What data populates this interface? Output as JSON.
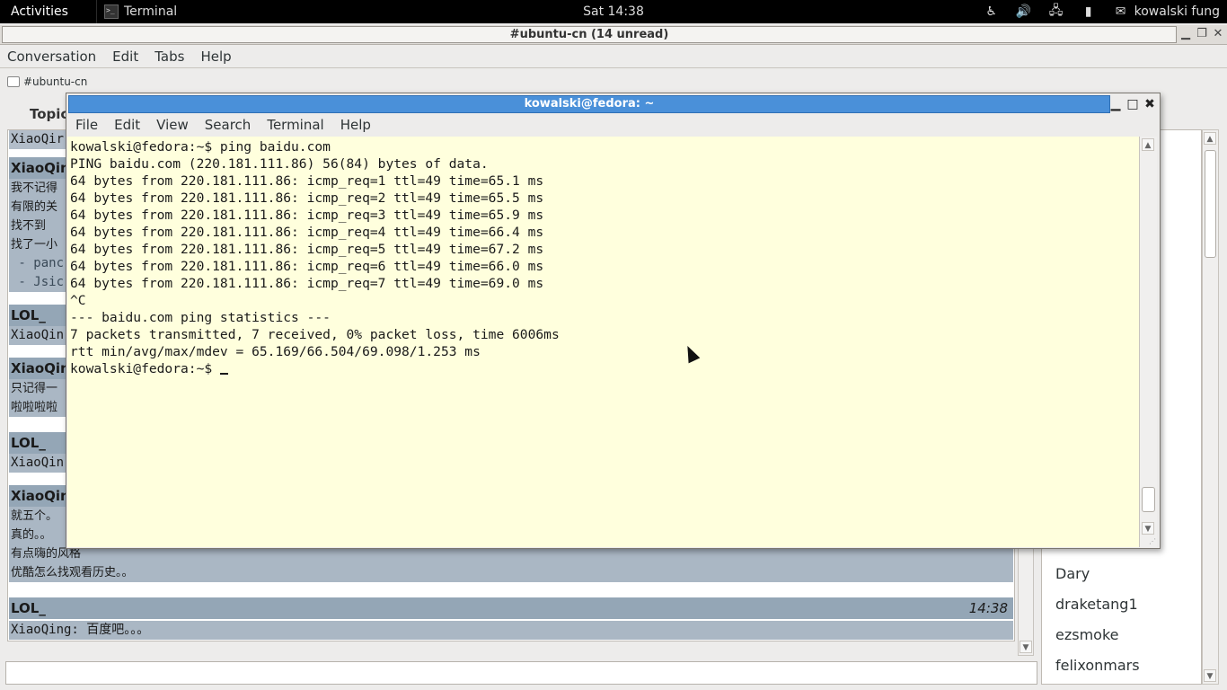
{
  "topbar": {
    "activities": "Activities",
    "app_name": "Terminal",
    "app_icon": "terminal-icon",
    "clock": "Sat 14:38",
    "status_icons": [
      "accessibility-icon",
      "volume-icon",
      "network-icon",
      "battery-icon",
      "user-icon"
    ],
    "user_name": "kowalski fung"
  },
  "xchat": {
    "window_title": "#ubuntu-cn (14 unread)",
    "menu": [
      "Conversation",
      "Edit",
      "Tabs",
      "Help"
    ],
    "tab_label": "#ubuntu-cn",
    "topic_label": "Topic",
    "messages": [
      {
        "nick": "XiaoQing",
        "lines": [
          "我不记得",
          "有限的关",
          "找不到",
          "找了一小",
          " - panc",
          " - Jsic"
        ]
      },
      {
        "nick": "LOL_",
        "lines": [
          "XiaoQin"
        ]
      },
      {
        "nick": "XiaoQing",
        "lines": [
          "只记得一",
          "啦啦啦啦"
        ]
      },
      {
        "nick": "LOL_",
        "lines": [
          "XiaoQin"
        ]
      },
      {
        "nick": "XiaoQing",
        "lines": [
          "就五个。",
          "真的。。",
          "有点嗨的风格",
          "优酷怎么找观看历史。。"
        ]
      },
      {
        "nick": "LOL_",
        "time": "14:38",
        "lines": [
          "XiaoQing: 百度吧。。。"
        ]
      }
    ],
    "first_line": "XiaoQir",
    "users": [
      "Dary",
      "draketang1",
      "ezsmoke",
      "felixonmars"
    ]
  },
  "terminal": {
    "title": "kowalski@fedora: ~",
    "menu": [
      "File",
      "Edit",
      "View",
      "Search",
      "Terminal",
      "Help"
    ],
    "lines": [
      "kowalski@fedora:~$ ping baidu.com",
      "PING baidu.com (220.181.111.86) 56(84) bytes of data.",
      "64 bytes from 220.181.111.86: icmp_req=1 ttl=49 time=65.1 ms",
      "64 bytes from 220.181.111.86: icmp_req=2 ttl=49 time=65.5 ms",
      "64 bytes from 220.181.111.86: icmp_req=3 ttl=49 time=65.9 ms",
      "64 bytes from 220.181.111.86: icmp_req=4 ttl=49 time=66.4 ms",
      "64 bytes from 220.181.111.86: icmp_req=5 ttl=49 time=67.2 ms",
      "64 bytes from 220.181.111.86: icmp_req=6 ttl=49 time=66.0 ms",
      "64 bytes from 220.181.111.86: icmp_req=7 ttl=49 time=69.0 ms",
      "^C",
      "--- baidu.com ping statistics ---",
      "7 packets transmitted, 7 received, 0% packet loss, time 6006ms",
      "rtt min/avg/max/mdev = 65.169/66.504/69.098/1.253 ms"
    ],
    "prompt": "kowalski@fedora:~$ "
  }
}
